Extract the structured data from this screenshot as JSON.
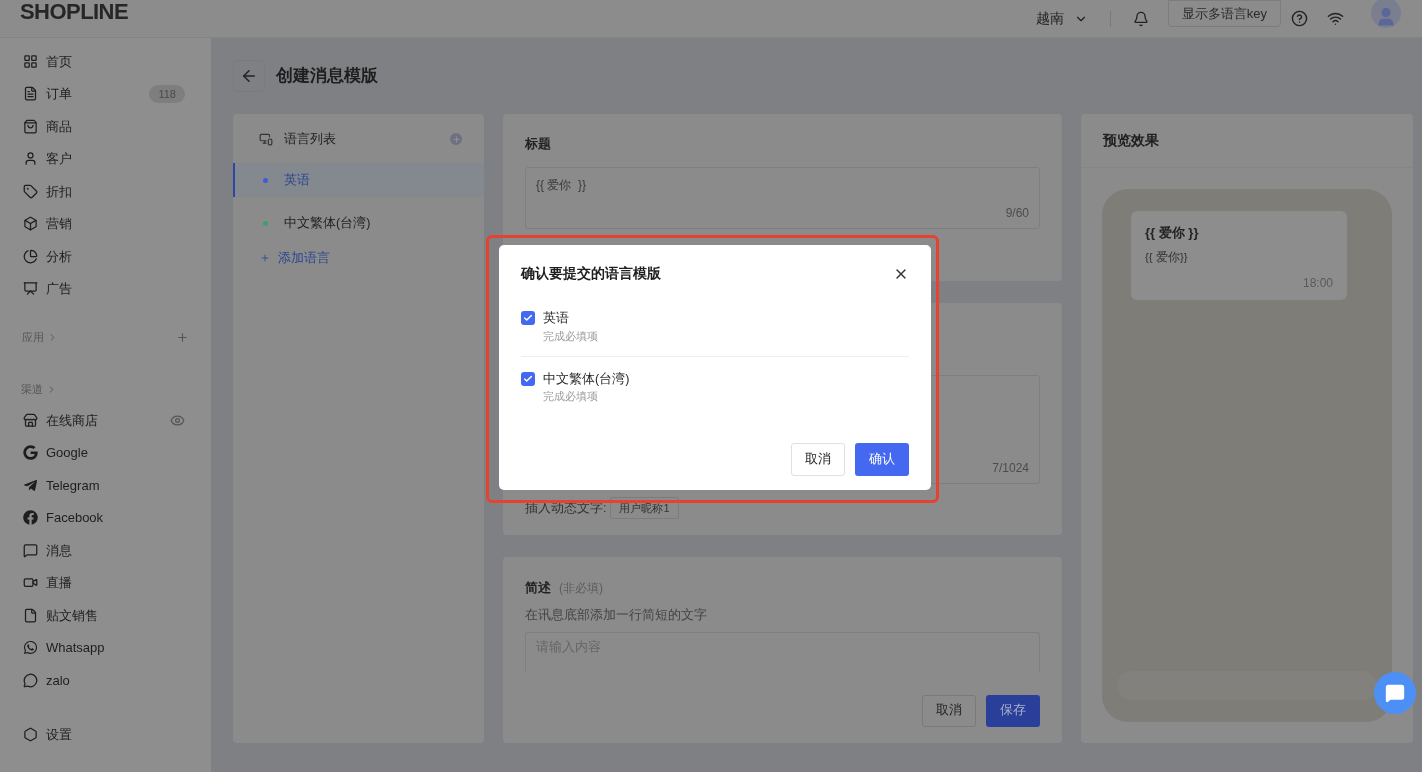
{
  "header": {
    "logo": "SHOPLINE",
    "region": "越南",
    "key_button": "显示多语言key"
  },
  "sidebar": {
    "items": [
      {
        "label": "首页"
      },
      {
        "label": "订单",
        "badge": "118"
      },
      {
        "label": "商品"
      },
      {
        "label": "客户"
      },
      {
        "label": "折扣"
      },
      {
        "label": "营销"
      },
      {
        "label": "分析"
      },
      {
        "label": "广告"
      }
    ],
    "apps_label": "应用",
    "channels_label": "渠道",
    "channels": [
      {
        "label": "在线商店"
      },
      {
        "label": "Google"
      },
      {
        "label": "Telegram"
      },
      {
        "label": "Facebook"
      },
      {
        "label": "消息"
      },
      {
        "label": "直播"
      },
      {
        "label": "贴文销售"
      },
      {
        "label": "Whatsapp"
      },
      {
        "label": "zalo"
      }
    ],
    "settings": "设置"
  },
  "page": {
    "title": "创建消息模版"
  },
  "languages": {
    "title": "语言列表",
    "items": [
      {
        "label": "英语",
        "selected": true,
        "color": "#3d5bd6"
      },
      {
        "label": "中文繁体(台湾)",
        "selected": false,
        "color": "#3f9f6a"
      }
    ],
    "add": "添加语言"
  },
  "title_card": {
    "label": "标题",
    "value": "{{ 爱你  }}",
    "counter": "9/60"
  },
  "content_card": {
    "counter": "7/1024",
    "insert_label": "插入动态文字:",
    "insert_chip": "用户昵称1"
  },
  "summary_card": {
    "label": "简述",
    "optional": "(非必填)",
    "description": "在讯息底部添加一行简短的文字",
    "placeholder": "请输入内容"
  },
  "actions": {
    "cancel": "取消",
    "save": "保存"
  },
  "preview": {
    "title": "预览效果",
    "bubble_title": "{{ 爱你 }}",
    "bubble_body": "{{ 爱你}}",
    "time": "18:00"
  },
  "modal": {
    "title": "确认要提交的语言模版",
    "items": [
      {
        "label": "英语",
        "note": "完成必填项",
        "checked": true
      },
      {
        "label": "中文繁体(台湾)",
        "note": "完成必填项",
        "checked": true
      }
    ],
    "cancel": "取消",
    "confirm": "确认"
  }
}
